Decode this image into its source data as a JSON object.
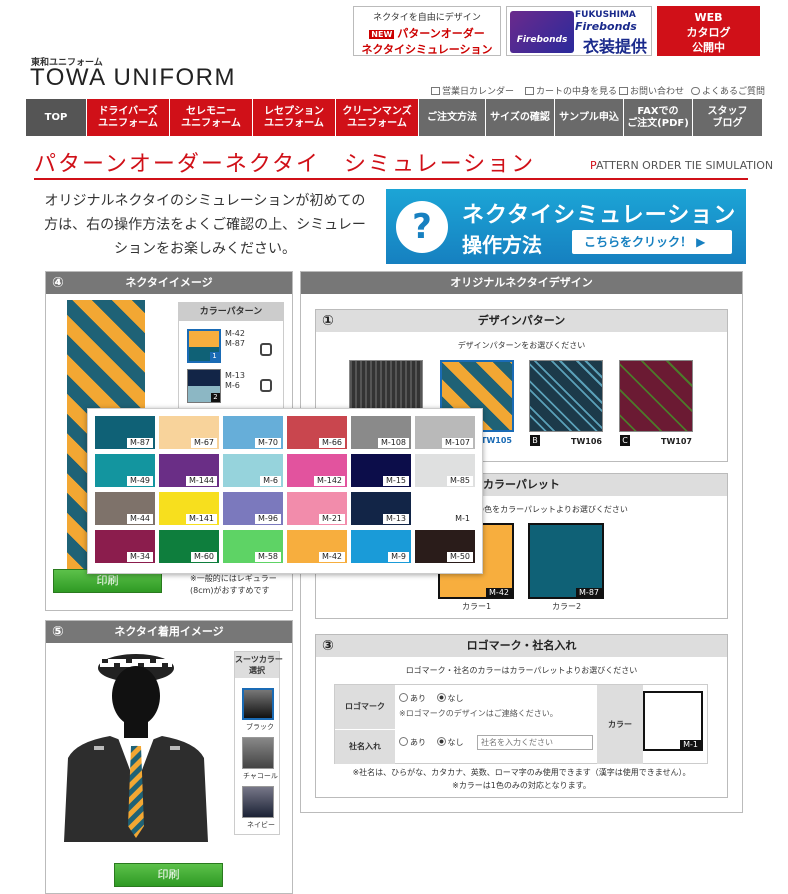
{
  "header": {
    "brand_sub": "東和ユニフォーム",
    "brand": "TOWA UNIFORM",
    "banner_pattern": {
      "line1": "ネクタイを自由にデザイン",
      "new_badge": "NEW",
      "line2": "パターンオーダー",
      "line3": "ネクタイシミュレーション"
    },
    "banner_firebonds": {
      "logo": "Firebonds",
      "line1": "FUKUSHIMA",
      "line2": "Firebonds",
      "line3": "衣装提供"
    },
    "banner_catalog": {
      "line1": "WEB",
      "line2": "カタログ",
      "line3": "公開中"
    },
    "utility_links": [
      "営業日カレンダー",
      "カートの中身を見る",
      "お問い合わせ",
      "よくあるご質問"
    ]
  },
  "nav": [
    {
      "label": "TOP",
      "style": "top"
    },
    {
      "label": "ドライバーズ\nユニフォーム",
      "style": "red"
    },
    {
      "label": "セレモニー\nユニフォーム",
      "style": "red"
    },
    {
      "label": "レセプション\nユニフォーム",
      "style": "red"
    },
    {
      "label": "クリーンマンズ\nユニフォーム",
      "style": "red"
    },
    {
      "label": "ご注文方法",
      "style": "gray"
    },
    {
      "label": "サイズの確認",
      "style": "gray"
    },
    {
      "label": "サンプル申込",
      "style": "gray"
    },
    {
      "label": "FAXでの\nご注文(PDF)",
      "style": "gray"
    },
    {
      "label": "スタッフ\nブログ",
      "style": "gray"
    }
  ],
  "page": {
    "title": "パターンオーダーネクタイ　シミュレーション",
    "title_en_first": "P",
    "title_en_rest": "ATTERN ORDER TIE SIMULATION",
    "intro": "オリジナルネクタイのシミュレーションが初めての方は、右の操作方法をよくご確認の上、シミュレーションをお楽しみください。",
    "howto_q": "?",
    "howto_line1": "ネクタイシミュレーション",
    "howto_line2": "操作方法",
    "howto_button": "こちらをクリック！ ▶"
  },
  "tie_image": {
    "num": "④",
    "title": "ネクタイイメージ",
    "color_pattern_title": "カラーパターン",
    "patterns": [
      {
        "codes": "M-42\nM-87",
        "index": "1"
      },
      {
        "codes": "M-13\nM-6",
        "index": "2"
      }
    ],
    "note": "※一般的にはレギュラー\n(8cm)がおすすめです",
    "print": "印刷"
  },
  "palette": [
    {
      "code": "M-87",
      "color": "#0f6176"
    },
    {
      "code": "M-67",
      "color": "#f8d39b"
    },
    {
      "code": "M-70",
      "color": "#66aed9"
    },
    {
      "code": "M-66",
      "color": "#c9464e"
    },
    {
      "code": "M-108",
      "color": "#8a8a8a"
    },
    {
      "code": "M-107",
      "color": "#b9b9b9"
    },
    {
      "code": "M-49",
      "color": "#13959f"
    },
    {
      "code": "M-144",
      "color": "#6a2e86"
    },
    {
      "code": "M-6",
      "color": "#96d3dc"
    },
    {
      "code": "M-142",
      "color": "#e2539e"
    },
    {
      "code": "M-15",
      "color": "#0c0d4a"
    },
    {
      "code": "M-85",
      "color": "#dfe0e0"
    },
    {
      "code": "M-44",
      "color": "#7e726a"
    },
    {
      "code": "M-141",
      "color": "#f7df1e"
    },
    {
      "code": "M-96",
      "color": "#7b79bd"
    },
    {
      "code": "M-21",
      "color": "#f28cab"
    },
    {
      "code": "M-13",
      "color": "#122547"
    },
    {
      "code": "M-1",
      "color": "#ffffff"
    },
    {
      "code": "M-34",
      "color": "#8b1d4d"
    },
    {
      "code": "M-60",
      "color": "#0e7e3d"
    },
    {
      "code": "M-58",
      "color": "#5ed365"
    },
    {
      "code": "M-42",
      "color": "#f7ae3e"
    },
    {
      "code": "M-9",
      "color": "#1a9bd8"
    },
    {
      "code": "M-50",
      "color": "#2a1c1a"
    }
  ],
  "design": {
    "title": "オリジナルネクタイデザイン",
    "pattern_num": "①",
    "pattern_title": "デザインパターン",
    "pattern_note": "デザインパターンをお選びください",
    "patterns": [
      {
        "code": "TW105",
        "letter": "A"
      },
      {
        "code": "TW106",
        "letter": "B"
      },
      {
        "code": "TW107",
        "letter": "C"
      }
    ],
    "palette_num": "②",
    "palette_title": "カラーパレット",
    "palette_note": "より2色のご希望の色をカラーパレットよりお選びください",
    "color1": {
      "code": "M-42",
      "label": "カラー1",
      "color": "#f7ae3e"
    },
    "color2": {
      "code": "M-87",
      "label": "カラー2",
      "color": "#0f6176"
    },
    "logo_num": "③",
    "logo_title": "ロゴマーク・社名入れ",
    "logo_note": "ロゴマーク・社名のカラーはカラーパレットよりお選びください",
    "logo_label": "ロゴマーク",
    "logo_yes": "あり",
    "logo_no": "なし",
    "logo_design_note": "※ロゴマークのデザインはご連絡ください。",
    "company_label": "社名入れ",
    "company_yes": "あり",
    "company_no": "なし",
    "company_placeholder": "社名を入力ください",
    "color_label": "カラー",
    "color_code": "M-1",
    "footnote1": "※社名は、ひらがな、カタカナ、英数、ローマ字のみ使用できます（漢字は使用できません）。",
    "footnote2": "※カラーは1色のみの対応となります。"
  },
  "wear": {
    "num": "⑤",
    "title": "ネクタイ着用イメージ",
    "suit_title": "スーツカラー\n選択",
    "suits": [
      "ブラック",
      "チャコール",
      "ネイビー"
    ],
    "print": "印刷"
  }
}
